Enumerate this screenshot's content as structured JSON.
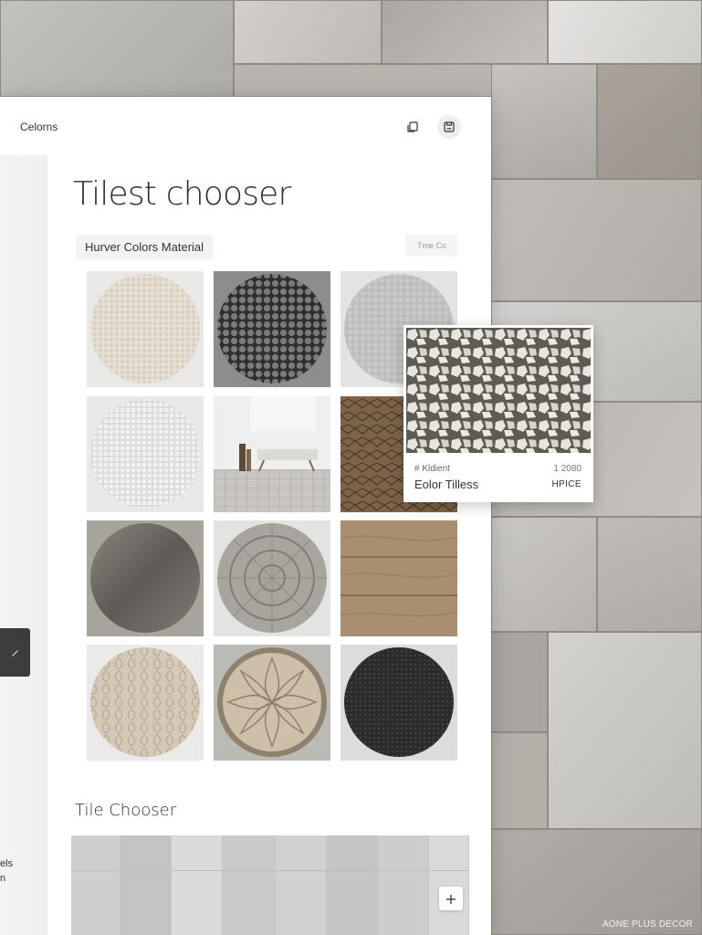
{
  "header": {
    "app_label": "Celorns",
    "icons": [
      "copy-icon",
      "save-icon"
    ]
  },
  "main": {
    "title": "Tilest chooser",
    "filter_chip": "Hurver Colors Material",
    "filter_chip_right": "Tme Co",
    "tiles": [
      {
        "name": "cream-mosaic-tile"
      },
      {
        "name": "dark-pebble-tile"
      },
      {
        "name": "grey-mosaic-tile"
      },
      {
        "name": "white-mosaic-tile"
      },
      {
        "name": "room-scene-tile"
      },
      {
        "name": "brown-cracked-tile"
      },
      {
        "name": "dark-marble-tile"
      },
      {
        "name": "ornamental-grey-tile"
      },
      {
        "name": "wood-plank-tile"
      },
      {
        "name": "beige-leaf-tile"
      },
      {
        "name": "carved-plate-tile"
      },
      {
        "name": "black-granite-tile"
      }
    ],
    "section_title": "Tile Chooser",
    "add_label": "+"
  },
  "sidebar": {
    "text_line1": "els",
    "text_line2": "n"
  },
  "preview": {
    "kicker": "# Kldient",
    "number": "1 2080",
    "name": "Eolor Tilless",
    "price": "HPICE"
  },
  "watermark": "AONE PLUS DECOR",
  "colors": {
    "window_bg": "#ffffff",
    "sidebar_dark": "#3c3c3c",
    "wall_stone": "#b9b6b0"
  }
}
